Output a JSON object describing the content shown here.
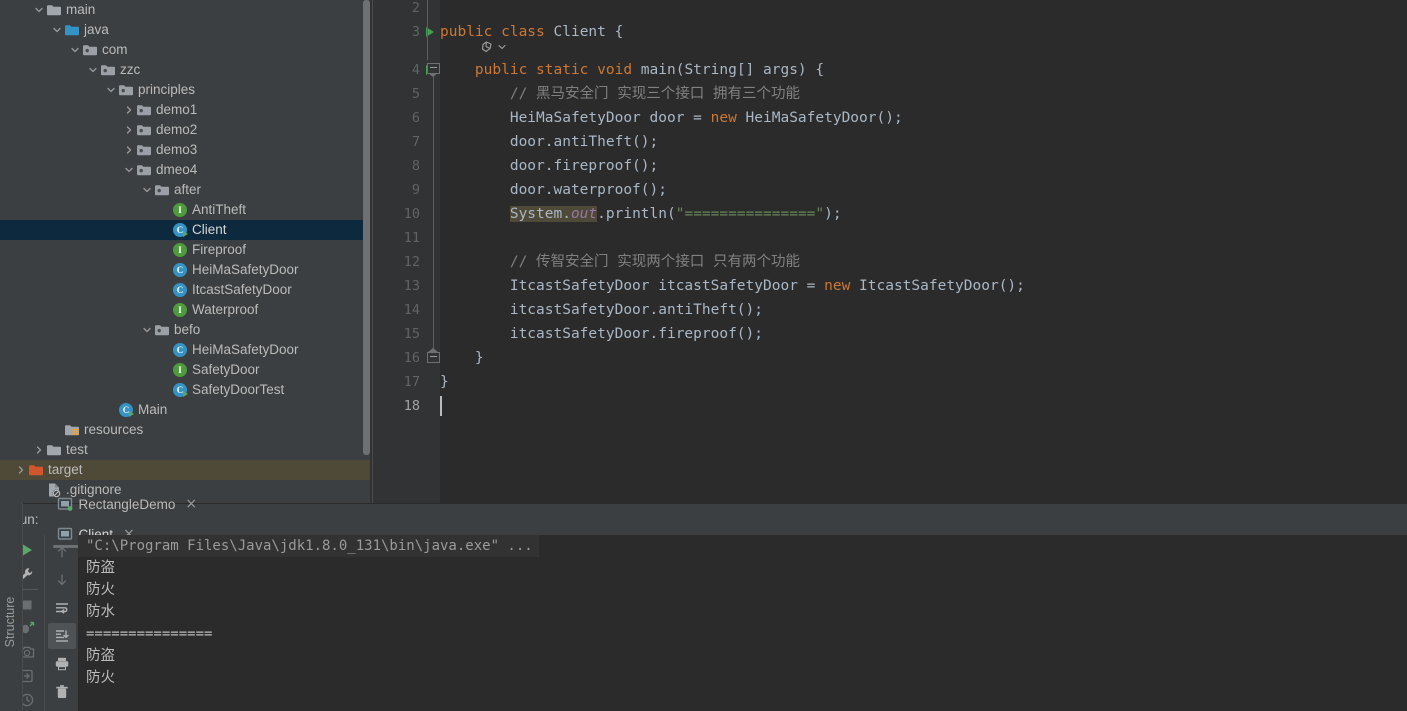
{
  "project_tree": {
    "rows": [
      {
        "label": "main",
        "indent": 3,
        "arrow": "down",
        "icon": "folder-gray",
        "state": "normal"
      },
      {
        "label": "java",
        "indent": 4,
        "arrow": "down",
        "icon": "folder-source",
        "state": "normal"
      },
      {
        "label": "com",
        "indent": 5,
        "arrow": "down",
        "icon": "folder-package",
        "state": "normal"
      },
      {
        "label": "zzc",
        "indent": 6,
        "arrow": "down",
        "icon": "folder-package",
        "state": "normal"
      },
      {
        "label": "principles",
        "indent": 7,
        "arrow": "down",
        "icon": "folder-package",
        "state": "normal"
      },
      {
        "label": "demo1",
        "indent": 8,
        "arrow": "right",
        "icon": "folder-package",
        "state": "normal"
      },
      {
        "label": "demo2",
        "indent": 8,
        "arrow": "right",
        "icon": "folder-package",
        "state": "normal"
      },
      {
        "label": "demo3",
        "indent": 8,
        "arrow": "right",
        "icon": "folder-package",
        "state": "normal"
      },
      {
        "label": "dmeo4",
        "indent": 8,
        "arrow": "down",
        "icon": "folder-package",
        "state": "normal"
      },
      {
        "label": "after",
        "indent": 9,
        "arrow": "down",
        "icon": "folder-package",
        "state": "normal"
      },
      {
        "label": "AntiTheft",
        "indent": 10,
        "arrow": "none",
        "icon": "interface",
        "state": "normal"
      },
      {
        "label": "Client",
        "indent": 10,
        "arrow": "none",
        "icon": "class-runnable",
        "state": "selected"
      },
      {
        "label": "Fireproof",
        "indent": 10,
        "arrow": "none",
        "icon": "interface",
        "state": "normal"
      },
      {
        "label": "HeiMaSafetyDoor",
        "indent": 10,
        "arrow": "none",
        "icon": "class",
        "state": "normal"
      },
      {
        "label": "ItcastSafetyDoor",
        "indent": 10,
        "arrow": "none",
        "icon": "class",
        "state": "normal"
      },
      {
        "label": "Waterproof",
        "indent": 10,
        "arrow": "none",
        "icon": "interface",
        "state": "normal"
      },
      {
        "label": "befo",
        "indent": 9,
        "arrow": "down",
        "icon": "folder-package",
        "state": "normal"
      },
      {
        "label": "HeiMaSafetyDoor",
        "indent": 10,
        "arrow": "none",
        "icon": "class",
        "state": "normal"
      },
      {
        "label": "SafetyDoor",
        "indent": 10,
        "arrow": "none",
        "icon": "interface",
        "state": "normal"
      },
      {
        "label": "SafetyDoorTest",
        "indent": 10,
        "arrow": "none",
        "icon": "class-runnable",
        "state": "normal"
      },
      {
        "label": "Main",
        "indent": 7,
        "arrow": "none",
        "icon": "class-runnable",
        "state": "normal"
      },
      {
        "label": "resources",
        "indent": 4,
        "arrow": "none",
        "icon": "folder-resources",
        "state": "normal"
      },
      {
        "label": "test",
        "indent": 3,
        "arrow": "right",
        "icon": "folder-gray",
        "state": "normal"
      },
      {
        "label": "target",
        "indent": 2,
        "arrow": "right",
        "icon": "folder-excluded",
        "state": "highlighted"
      },
      {
        "label": ".gitignore",
        "indent": 3,
        "arrow": "none",
        "icon": "file-ignored",
        "state": "normal"
      }
    ]
  },
  "editor": {
    "first_visible_line": 2,
    "current_line": 18,
    "lines": [
      {
        "n": 2,
        "runnable": false,
        "tokens": []
      },
      {
        "n": 3,
        "runnable": true,
        "tokens": [
          {
            "t": "public class ",
            "c": "kw"
          },
          {
            "t": "Client",
            "c": "cls"
          },
          {
            "t": " {",
            "c": "txt"
          }
        ]
      },
      {
        "n": 4,
        "runnable": true,
        "tokens": [
          {
            "t": "    ",
            "c": "txt"
          },
          {
            "t": "public static void ",
            "c": "kw"
          },
          {
            "t": "main",
            "c": "cls"
          },
          {
            "t": "(String[] args) {",
            "c": "txt"
          }
        ]
      },
      {
        "n": 5,
        "runnable": false,
        "tokens": [
          {
            "t": "        ",
            "c": "txt"
          },
          {
            "t": "// 黑马安全门 实现三个接口 拥有三个功能",
            "c": "cmt"
          }
        ]
      },
      {
        "n": 6,
        "runnable": false,
        "tokens": [
          {
            "t": "        HeiMaSafetyDoor door = ",
            "c": "txt"
          },
          {
            "t": "new ",
            "c": "kw"
          },
          {
            "t": "HeiMaSafetyDoor();",
            "c": "txt"
          }
        ]
      },
      {
        "n": 7,
        "runnable": false,
        "tokens": [
          {
            "t": "        door.antiTheft();",
            "c": "txt"
          }
        ]
      },
      {
        "n": 8,
        "runnable": false,
        "tokens": [
          {
            "t": "        door.fireproof();",
            "c": "txt"
          }
        ]
      },
      {
        "n": 9,
        "runnable": false,
        "tokens": [
          {
            "t": "        door.waterproof();",
            "c": "txt"
          }
        ]
      },
      {
        "n": 10,
        "runnable": false,
        "tokens": [
          {
            "t": "        ",
            "c": "txt"
          },
          {
            "t": "System.",
            "c": "txt hl-sysout"
          },
          {
            "t": "out",
            "c": "fld hl-sysout"
          },
          {
            "t": ".println(",
            "c": "txt"
          },
          {
            "t": "\"===============\"",
            "c": "str"
          },
          {
            "t": ");",
            "c": "txt"
          }
        ]
      },
      {
        "n": 11,
        "runnable": false,
        "tokens": []
      },
      {
        "n": 12,
        "runnable": false,
        "tokens": [
          {
            "t": "        ",
            "c": "txt"
          },
          {
            "t": "// 传智安全门 实现两个接口 只有两个功能",
            "c": "cmt"
          }
        ]
      },
      {
        "n": 13,
        "runnable": false,
        "tokens": [
          {
            "t": "        ItcastSafetyDoor itcastSafetyDoor = ",
            "c": "txt"
          },
          {
            "t": "new ",
            "c": "kw"
          },
          {
            "t": "ItcastSafetyDoor();",
            "c": "txt"
          }
        ]
      },
      {
        "n": 14,
        "runnable": false,
        "tokens": [
          {
            "t": "        itcastSafetyDoor.antiTheft();",
            "c": "txt"
          }
        ]
      },
      {
        "n": 15,
        "runnable": false,
        "tokens": [
          {
            "t": "        itcastSafetyDoor.fireproof();",
            "c": "txt"
          }
        ]
      },
      {
        "n": 16,
        "runnable": false,
        "tokens": [
          {
            "t": "    }",
            "c": "txt"
          }
        ]
      },
      {
        "n": 17,
        "runnable": false,
        "tokens": [
          {
            "t": "}",
            "c": "txt"
          }
        ]
      },
      {
        "n": 18,
        "runnable": false,
        "tokens": []
      }
    ]
  },
  "run_panel": {
    "label": "Run:",
    "tabs": [
      {
        "name": "RectangleDemo",
        "active": false,
        "close": "×"
      },
      {
        "name": "Client",
        "active": true,
        "close": "×"
      }
    ],
    "toolbar_primary": [
      {
        "icon": "rerun-icon",
        "enabled": true,
        "pressed": false
      },
      {
        "icon": "settings-wrench-icon",
        "enabled": true,
        "pressed": false
      },
      {
        "icon": "stop-icon",
        "enabled": false,
        "pressed": false
      },
      {
        "icon": "debug-rerun-icon",
        "enabled": false,
        "pressed": false
      },
      {
        "icon": "screenshot-icon",
        "enabled": false,
        "pressed": false
      },
      {
        "icon": "export-icon",
        "enabled": false,
        "pressed": false
      },
      {
        "icon": "history-icon",
        "enabled": false,
        "pressed": false
      }
    ],
    "toolbar_secondary": [
      {
        "icon": "arrow-up-icon",
        "enabled": false,
        "pressed": false
      },
      {
        "icon": "arrow-down-icon",
        "enabled": false,
        "pressed": false
      },
      {
        "icon": "soft-wrap-icon",
        "enabled": true,
        "pressed": false
      },
      {
        "icon": "scroll-to-end-icon",
        "enabled": true,
        "pressed": true
      },
      {
        "icon": "print-icon",
        "enabled": true,
        "pressed": false
      },
      {
        "icon": "trash-icon",
        "enabled": true,
        "pressed": false
      }
    ],
    "console_lines": [
      {
        "text": "\"C:\\Program Files\\Java\\jdk1.8.0_131\\bin\\java.exe\" ...",
        "kind": "cmd"
      },
      {
        "text": "防盗",
        "kind": "cn"
      },
      {
        "text": "防火",
        "kind": "cn"
      },
      {
        "text": "防水",
        "kind": "cn"
      },
      {
        "text": "===============",
        "kind": "mono"
      },
      {
        "text": "防盗",
        "kind": "cn"
      },
      {
        "text": "防火",
        "kind": "cn"
      }
    ]
  },
  "left_rail": {
    "structure_label": "Structure"
  },
  "colors": {
    "panel_bg": "#3C3F41",
    "editor_bg": "#2B2B2B",
    "gutter_bg": "#313335",
    "selection_blue": "#0D293E",
    "highlight_olive": "#4E4A37",
    "keyword_orange": "#CC7832",
    "identifier": "#A9B7C6",
    "comment_gray": "#808080",
    "string_green": "#6A8759",
    "field_purple": "#9876AA",
    "interface_green": "#4E9A3D",
    "class_blue": "#3592C4",
    "run_green": "#499C54",
    "target_orange": "#D2562C"
  }
}
